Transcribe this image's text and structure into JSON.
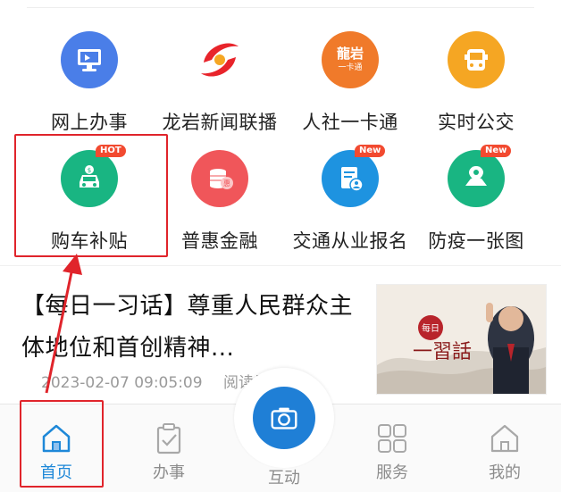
{
  "colors": {
    "accent": "#1e88d8",
    "highlight": "#e0242b",
    "badge": "#f24a30"
  },
  "services": [
    {
      "label": "网上办事",
      "icon": "computer-icon",
      "color": "#4a7ee8"
    },
    {
      "label": "龙岩新闻联播",
      "icon": "news-logo-icon",
      "color": "#ffffff"
    },
    {
      "label": "人社一卡通",
      "icon": "social-card-icon",
      "color": "#f07a2a"
    },
    {
      "label": "实时公交",
      "icon": "bus-icon",
      "color": "#f5a623"
    },
    {
      "label": "购车补贴",
      "icon": "car-icon",
      "color": "#19b582",
      "badge": "HOT"
    },
    {
      "label": "普惠金融",
      "icon": "coins-icon",
      "color": "#f0565a"
    },
    {
      "label": "交通从业报名",
      "icon": "registration-icon",
      "color": "#1e93e0",
      "badge": "New"
    },
    {
      "label": "防疫一张图",
      "icon": "map-icon",
      "color": "#19b582",
      "badge": "New"
    }
  ],
  "thumb_text": {
    "small": "每日",
    "large": "一習話"
  },
  "social_card_text": {
    "top": "龍岩",
    "bottom": "一卡通"
  },
  "coins_text": "惠",
  "news": {
    "title": "【每日一习话】尊重人民群众主体地位和首创精神...",
    "date": "2023-02-07 09:05:09",
    "reads": "阅读量 3820"
  },
  "tabs": [
    {
      "label": "首页",
      "icon": "home-icon",
      "active": true
    },
    {
      "label": "办事",
      "icon": "clipboard-icon"
    },
    {
      "label": "互动",
      "icon": "camera-icon"
    },
    {
      "label": "服务",
      "icon": "grid-icon"
    },
    {
      "label": "我的",
      "icon": "user-home-icon"
    }
  ]
}
